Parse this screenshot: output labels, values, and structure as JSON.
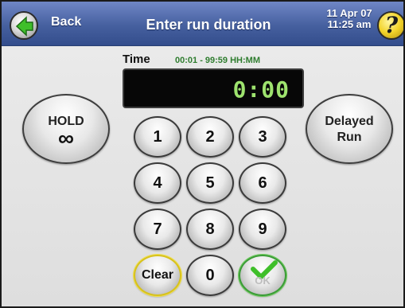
{
  "header": {
    "back_label": "Back",
    "title": "Enter run duration",
    "date": "11 Apr 07",
    "time": "11:25 am",
    "help_symbol": "?"
  },
  "time_entry": {
    "label": "Time",
    "range": "00:01 - 99:59  HH:MM",
    "display_value": "0:00"
  },
  "side_buttons": {
    "hold_line1": "HOLD",
    "hold_symbol": "∞",
    "delayed_line1": "Delayed",
    "delayed_line2": "Run"
  },
  "keypad": {
    "k1": "1",
    "k2": "2",
    "k3": "3",
    "k4": "4",
    "k5": "5",
    "k6": "6",
    "k7": "7",
    "k8": "8",
    "k9": "9",
    "clear": "Clear",
    "k0": "0",
    "ok": "OK"
  },
  "icons": {
    "back": "back-arrow-icon",
    "help": "help-icon",
    "ok": "checkmark-icon"
  },
  "colors": {
    "header": "#46609f",
    "display_text": "#9ee36e",
    "range_text": "#2f7d2f",
    "clear_ring": "#d8c21a",
    "ok_ring": "#3a9c36"
  }
}
